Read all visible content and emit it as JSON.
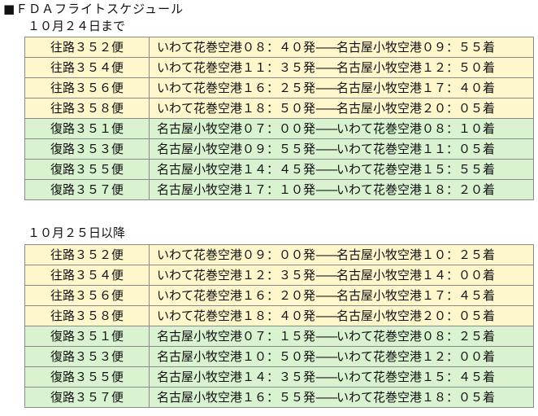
{
  "title": "■ＦＤＡフライトスケジュール",
  "sections": [
    {
      "label": "１０月２４日まで",
      "rows": [
        {
          "type": "outbound",
          "flight": "往路３５２便",
          "dep": "いわて花巻空港０８：４０発",
          "sep": "——",
          "arr": "名古屋小牧空港０９：５５着"
        },
        {
          "type": "outbound",
          "flight": "往路３５４便",
          "dep": "いわて花巻空港１１：３５発",
          "sep": "——",
          "arr": "名古屋小牧空港１２：５０着"
        },
        {
          "type": "outbound",
          "flight": "往路３５６便",
          "dep": "いわて花巻空港１６：２５発",
          "sep": "——",
          "arr": "名古屋小牧空港１７：４０着"
        },
        {
          "type": "outbound",
          "flight": "往路３５８便",
          "dep": "いわて花巻空港１８：５０発",
          "sep": "——",
          "arr": "名古屋小牧空港２０：０５着"
        },
        {
          "type": "inbound",
          "flight": "復路３５１便",
          "dep": "名古屋小牧空港０７：００発",
          "sep": "——",
          "arr": "いわて花巻空港０８：１０着"
        },
        {
          "type": "inbound",
          "flight": "復路３５３便",
          "dep": "名古屋小牧空港０９：５５発",
          "sep": "——",
          "arr": "いわて花巻空港１１：０５着"
        },
        {
          "type": "inbound",
          "flight": "復路３５５便",
          "dep": "名古屋小牧空港１４：４５発",
          "sep": "——",
          "arr": "いわて花巻空港１５：５５着"
        },
        {
          "type": "inbound",
          "flight": "復路３５７便",
          "dep": "名古屋小牧空港１７：１０発",
          "sep": "——",
          "arr": "いわて花巻空港１８：２０着"
        }
      ]
    },
    {
      "label": "１０月２５日以降",
      "rows": [
        {
          "type": "outbound",
          "flight": "往路３５２便",
          "dep": "いわて花巻空港０９：００発",
          "sep": "——",
          "arr": "名古屋小牧空港１０：２５着"
        },
        {
          "type": "outbound",
          "flight": "往路３５４便",
          "dep": "いわて花巻空港１２：３５発",
          "sep": "——",
          "arr": "名古屋小牧空港１４：００着"
        },
        {
          "type": "outbound",
          "flight": "往路３５６便",
          "dep": "いわて花巻空港１６：２０発",
          "sep": "——",
          "arr": "名古屋小牧空港１７：４５着"
        },
        {
          "type": "outbound",
          "flight": "往路３５８便",
          "dep": "いわて花巻空港１８：４０発",
          "sep": "——",
          "arr": "名古屋小牧空港２０：０５着"
        },
        {
          "type": "inbound",
          "flight": "復路３５１便",
          "dep": "名古屋小牧空港０７：１５発",
          "sep": "——",
          "arr": "いわて花巻空港０８：２５着"
        },
        {
          "type": "inbound",
          "flight": "復路３５３便",
          "dep": "名古屋小牧空港１０：５０発",
          "sep": "——",
          "arr": "いわて花巻空港１２：００着"
        },
        {
          "type": "inbound",
          "flight": "復路３５５便",
          "dep": "名古屋小牧空港１４：３５発",
          "sep": "——",
          "arr": "いわて花巻空港１５：４５着"
        },
        {
          "type": "inbound",
          "flight": "復路３５７便",
          "dep": "名古屋小牧空港１６：５５発",
          "sep": "——",
          "arr": "いわて花巻空港１８：０５着"
        }
      ]
    }
  ],
  "colors": {
    "outbound_background": "#fff7cc",
    "inbound_background": "#d9f2d0",
    "border": "#8a8a8a"
  }
}
